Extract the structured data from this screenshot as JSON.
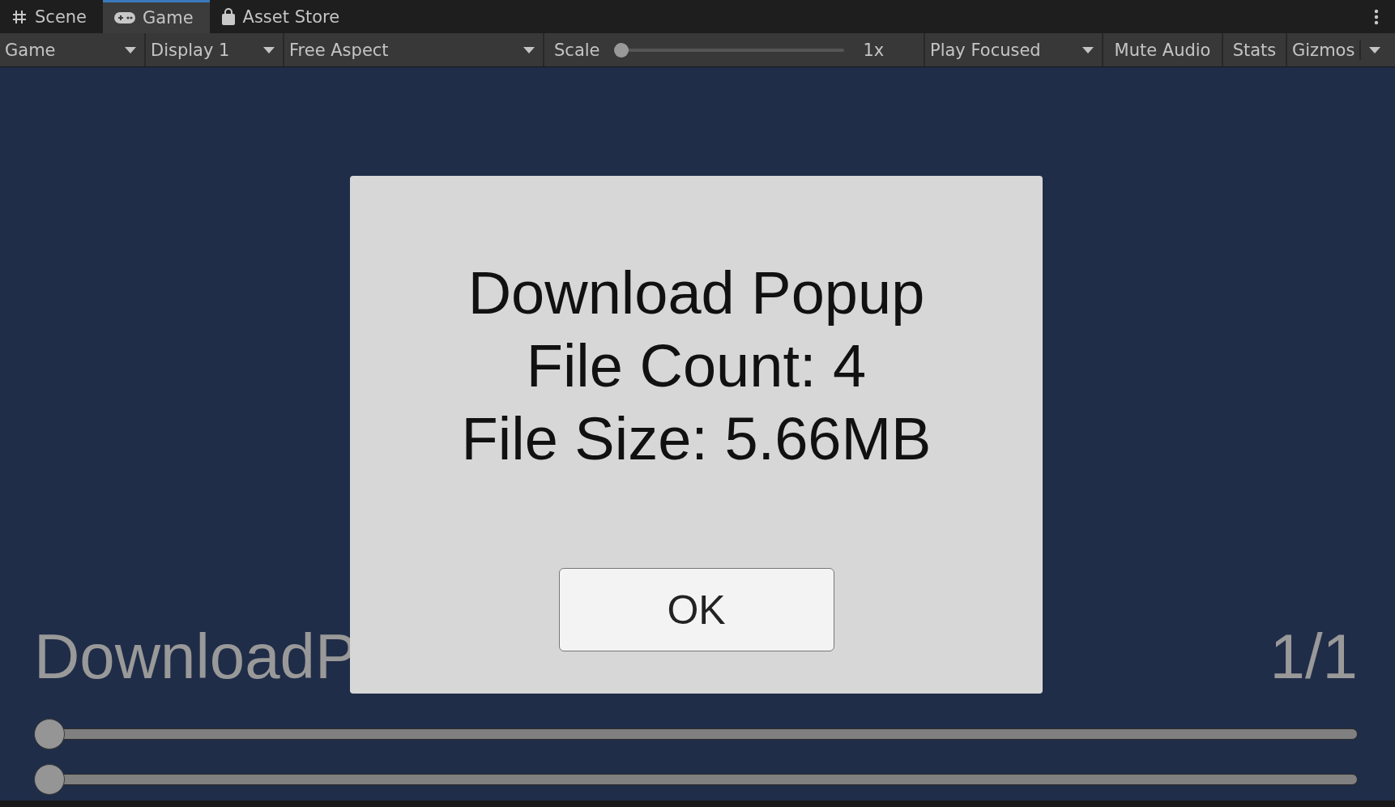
{
  "tabs": [
    {
      "label": "Scene",
      "selected": false
    },
    {
      "label": "Game",
      "selected": true
    },
    {
      "label": "Asset Store",
      "selected": false
    }
  ],
  "toolbar": [
    {
      "kind": "dropdown",
      "label": "Game"
    },
    {
      "kind": "dropdown",
      "label": "Display 1"
    },
    {
      "kind": "dropdown",
      "label": "Free Aspect"
    },
    {
      "kind": "slider",
      "label": "Scale",
      "level": 0,
      "reading": "1x"
    },
    {
      "kind": "dropdown",
      "label": "Play Focused"
    },
    {
      "kind": "button",
      "label": "Mute Audio"
    },
    {
      "kind": "button",
      "label": "Stats"
    },
    {
      "kind": "split",
      "label": "Gizmos"
    }
  ],
  "game_view": {
    "title": "DownloadP",
    "counter": "1/1",
    "sliders": [
      {
        "level": 0
      },
      {
        "level": 0
      }
    ],
    "popup": {
      "lines": [
        "Download Popup",
        "File Count: 4",
        "File Size: 5.66MB"
      ],
      "button": "OK"
    }
  }
}
